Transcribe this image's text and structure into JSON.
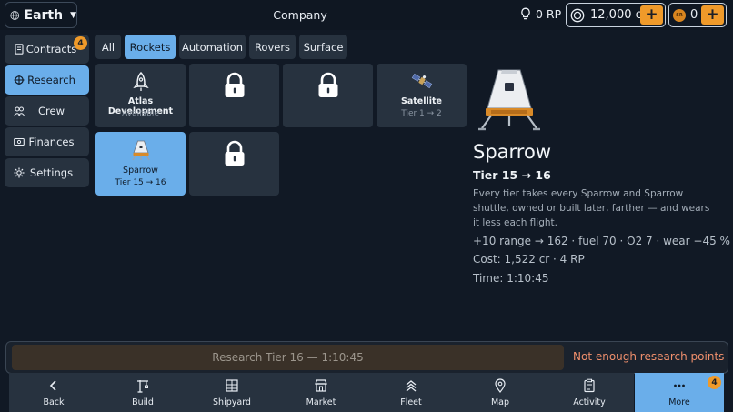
{
  "header": {
    "planet": "Earth",
    "title": "Company",
    "research_points": "0 RP",
    "credits": "12,000 cr",
    "sr_label": "SR",
    "sr_value": "0",
    "plus": "+"
  },
  "sidebar": {
    "items": [
      {
        "label": "Contracts",
        "badge": "4"
      },
      {
        "label": "Research"
      },
      {
        "label": "Crew"
      },
      {
        "label": "Finances"
      },
      {
        "label": "Settings"
      }
    ]
  },
  "tabs": [
    "All",
    "Rockets",
    "Automation",
    "Rovers",
    "Surface"
  ],
  "tiles": [
    {
      "name": "Atlas Development",
      "sub": "Available"
    },
    {
      "name": "Satellite",
      "sub": "Tier 1 → 2"
    },
    {
      "name": "Sparrow",
      "sub": "Tier 15 → 16"
    }
  ],
  "detail": {
    "name": "Sparrow",
    "tier": "Tier 15 → 16",
    "description": "Every tier takes every Sparrow and Sparrow shuttle, owned or built later, farther — and wears it less each flight.",
    "stats": "+10 range → 162 · fuel 70 · O2 7 · wear −45 %",
    "cost": "Cost: 1,522 cr · 4 RP",
    "time": "Time: 1:10:45"
  },
  "research": {
    "button": "Research Tier 16 — 1:10:45",
    "warning": "Not enough research points"
  },
  "nav": {
    "items": [
      {
        "label": "Back"
      },
      {
        "label": "Build"
      },
      {
        "label": "Shipyard"
      },
      {
        "label": "Market"
      },
      {
        "label": "Fleet"
      },
      {
        "label": "Map"
      },
      {
        "label": "Activity"
      },
      {
        "label": "More",
        "badge": "4"
      }
    ]
  },
  "colors": {
    "accent": "#6aaeea",
    "orange": "#ef9a2a",
    "warning": "#ef8f6c",
    "panel": "#27323f",
    "background": "#111925"
  },
  "icons": [
    "globe-icon",
    "lightbulb-icon",
    "coin-icon",
    "sr-coin-icon",
    "contracts-icon",
    "research-icon",
    "crew-icon",
    "finances-icon",
    "settings-icon",
    "rocket-icon",
    "lock-icon",
    "satellite-icon",
    "capsule-icon",
    "back-icon",
    "build-icon",
    "shipyard-icon",
    "market-icon",
    "fleet-icon",
    "map-icon",
    "activity-icon",
    "more-icon"
  ]
}
